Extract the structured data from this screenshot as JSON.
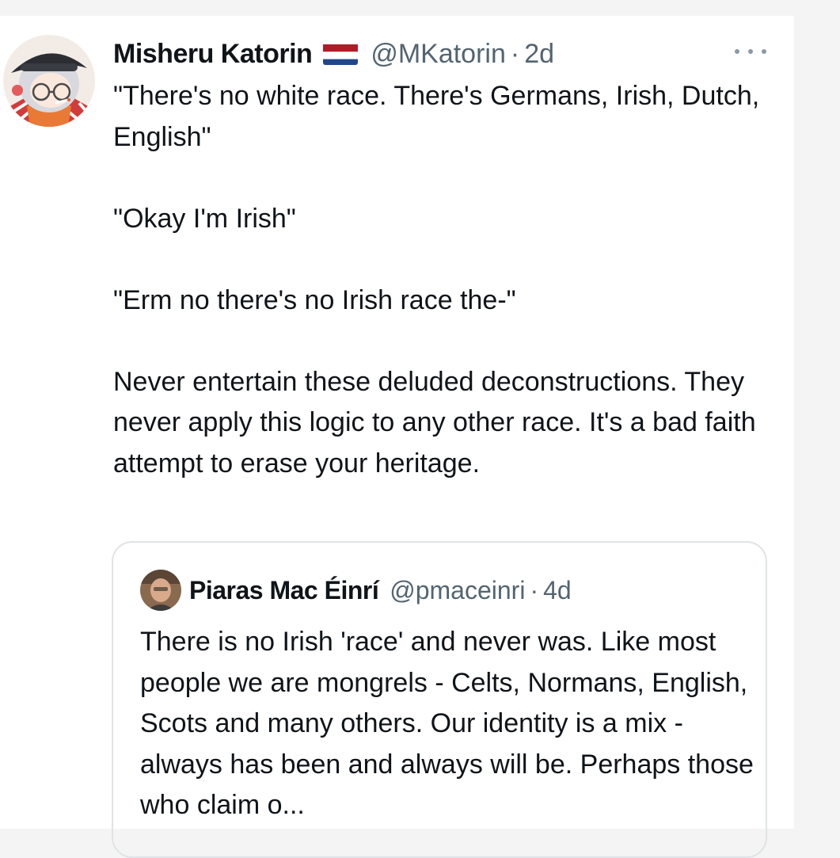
{
  "tweet": {
    "author_name": "Misheru Katorin",
    "flag_icon": "netherlands-flag-icon",
    "handle": "@MKatorin",
    "separator": "·",
    "time": "2d",
    "more_icon": "more-options-icon",
    "paragraphs": [
      "\"There's no white race. There's Germans, Irish, Dutch, English\"",
      "\"Okay I'm Irish\"",
      "\"Erm no there's no Irish race the-\"",
      "Never entertain these deluded deconstructions. They never apply this logic to any other race. It's a bad faith attempt to erase your heritage."
    ]
  },
  "quoted_tweet": {
    "author_name": "Piaras Mac Éinrí",
    "handle": "@pmaceinri",
    "separator": "·",
    "time": "4d",
    "text": "There is no Irish 'race' and never was. Like most people we are mongrels - Celts, Normans, English, Scots and many others. Our identity is a mix - always has been and always will be. Perhaps those who claim o..."
  },
  "colors": {
    "text": "#0f1419",
    "secondary_text": "#536471",
    "border": "#dfe3e6",
    "flag_red": "#ae1c28",
    "flag_white": "#ffffff",
    "flag_blue": "#21468b"
  }
}
